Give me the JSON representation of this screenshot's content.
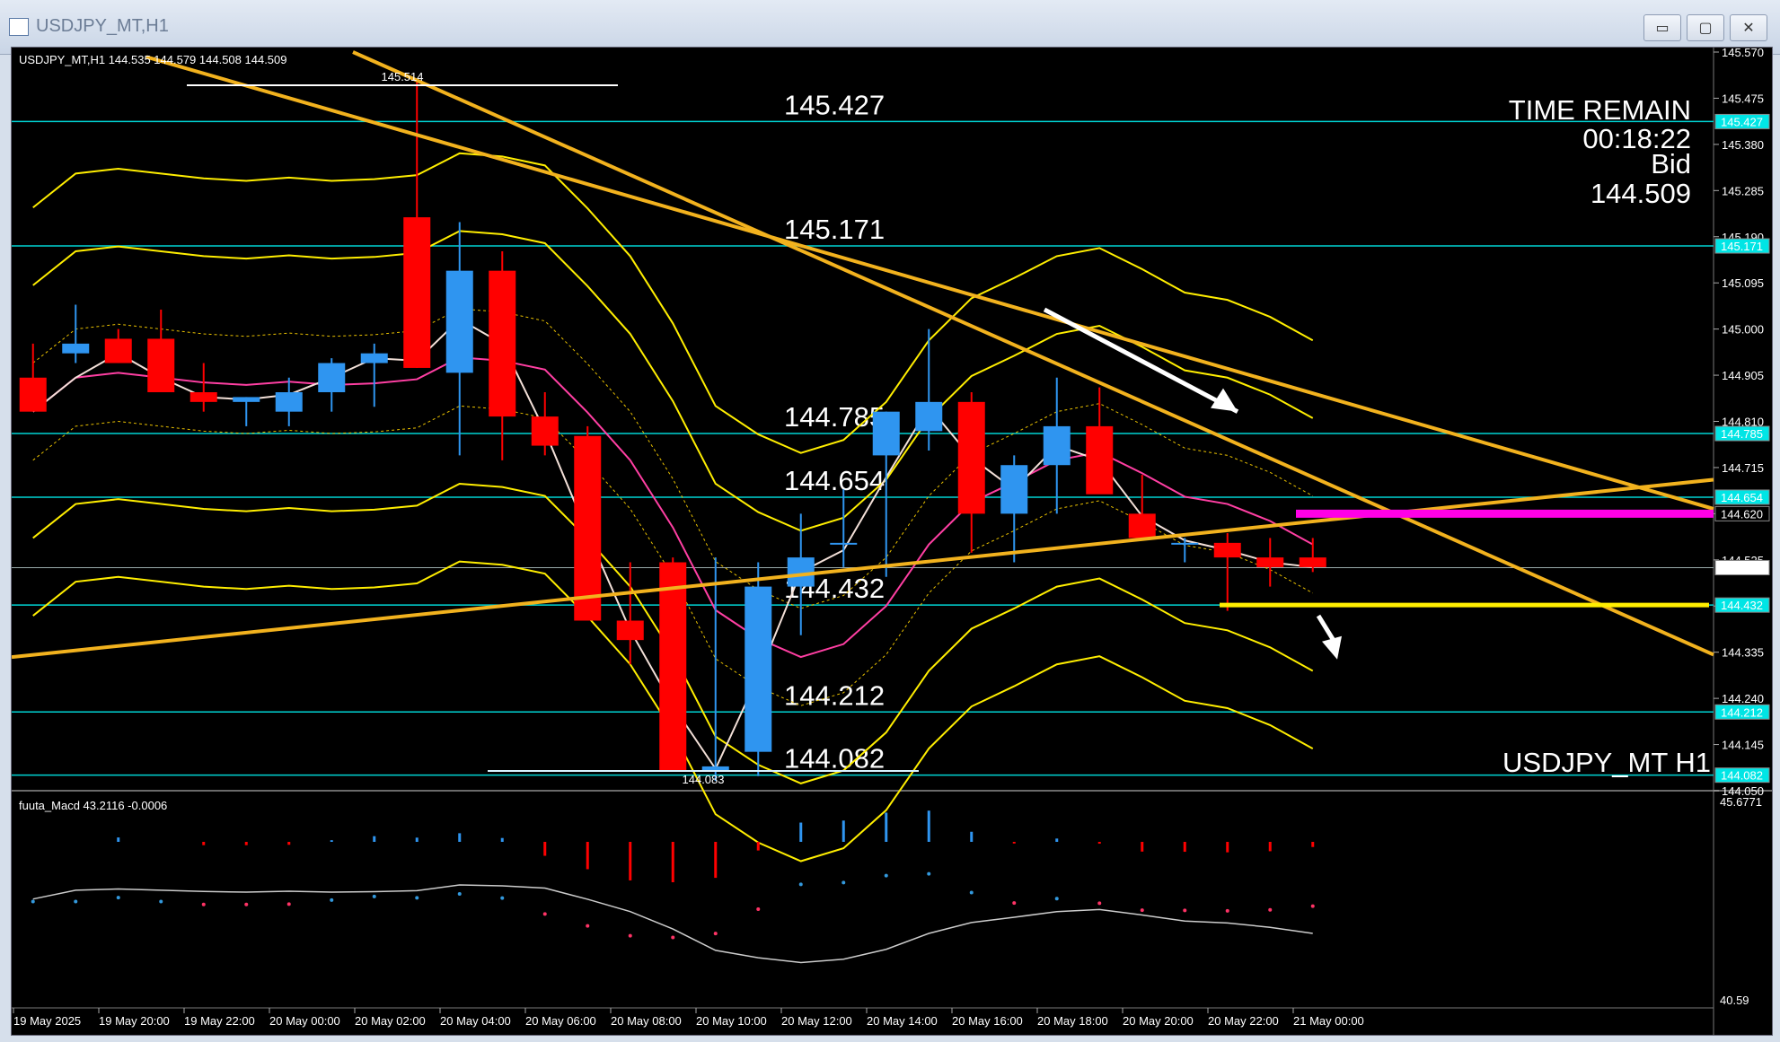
{
  "window": {
    "title": "USDJPY_MT,H1",
    "buttons": [
      "▭",
      "▢",
      "✕"
    ]
  },
  "chart": {
    "info_line": "USDJPY_MT,H1  144.535 144.579 144.508 144.509",
    "high_marker": "145.514",
    "low_marker": "144.083",
    "time_remain_label": "TIME REMAIN",
    "time_remain_value": "00:18:22",
    "bid_label": "Bid",
    "bid_value": "144.509",
    "symbol_watermark": "USDJPY_MT H1",
    "level_labels": [
      "145.427",
      "145.171",
      "144.785",
      "144.654",
      "144.432",
      "144.212",
      "144.082"
    ],
    "price_axis": [
      "145.570",
      "145.475",
      "145.380",
      "145.285",
      "145.190",
      "145.095",
      "145.000",
      "144.905",
      "144.810",
      "144.715",
      "144.620",
      "144.525",
      "144.430",
      "144.335",
      "144.240",
      "144.145",
      "144.050"
    ],
    "price_tags": [
      {
        "value": "145.427",
        "color": "#00e5e5"
      },
      {
        "value": "145.171",
        "color": "#00e5e5"
      },
      {
        "value": "144.785",
        "color": "#00e5e5"
      },
      {
        "value": "144.654",
        "color": "#00e5e5"
      },
      {
        "value": "144.620",
        "color": "#000000"
      },
      {
        "value": "144.509",
        "color": "#ffffff"
      },
      {
        "value": "144.432",
        "color": "#00e5e5"
      },
      {
        "value": "144.212",
        "color": "#00e5e5"
      },
      {
        "value": "144.082",
        "color": "#00e5e5"
      }
    ],
    "time_axis": [
      "19 May 2025",
      "19 May 20:00",
      "19 May 22:00",
      "20 May 00:00",
      "20 May 02:00",
      "20 May 04:00",
      "20 May 06:00",
      "20 May 08:00",
      "20 May 10:00",
      "20 May 12:00",
      "20 May 14:00",
      "20 May 16:00",
      "20 May 18:00",
      "20 May 20:00",
      "20 May 22:00",
      "21 May 00:00"
    ]
  },
  "macd": {
    "label": "fuuta_Macd 43.2116  -0.0006",
    "axis_top": "45.6771",
    "axis_bottom": "40.59"
  },
  "colors": {
    "bull": "#2f95f0",
    "bear": "#ff0000",
    "level_line": "#00d4d4",
    "trendline": "#f2b21e",
    "band": "#ffee00",
    "magenta": "#ff00e6"
  },
  "chart_data": {
    "type": "candlestick",
    "title": "USDJPY_MT,H1",
    "x": [
      "19 May 2025 18:00",
      "19 May 19:00",
      "19 May 20:00",
      "19 May 21:00",
      "19 May 22:00",
      "19 May 23:00",
      "20 May 00:00",
      "20 May 01:00",
      "20 May 02:00",
      "20 May 03:00",
      "20 May 04:00",
      "20 May 05:00",
      "20 May 06:00",
      "20 May 07:00",
      "20 May 08:00",
      "20 May 09:00",
      "20 May 10:00",
      "20 May 11:00",
      "20 May 12:00",
      "20 May 13:00",
      "20 May 14:00",
      "20 May 15:00",
      "20 May 16:00",
      "20 May 17:00",
      "20 May 18:00",
      "20 May 19:00",
      "20 May 20:00",
      "20 May 21:00",
      "20 May 22:00",
      "20 May 23:00",
      "21 May 00:00"
    ],
    "open": [
      144.9,
      144.95,
      144.98,
      144.98,
      144.87,
      144.85,
      144.83,
      144.87,
      144.93,
      145.23,
      144.91,
      145.12,
      144.82,
      144.78,
      144.4,
      144.52,
      144.09,
      144.13,
      144.47,
      144.56,
      144.74,
      144.79,
      144.85,
      144.62,
      144.72,
      144.8,
      144.62,
      144.56,
      144.56,
      144.53,
      144.53
    ],
    "high": [
      144.97,
      145.05,
      145.0,
      145.04,
      144.93,
      144.86,
      144.9,
      144.94,
      144.97,
      145.51,
      145.22,
      145.16,
      144.87,
      144.8,
      144.52,
      144.53,
      144.53,
      144.52,
      144.62,
      144.67,
      144.83,
      145.0,
      144.87,
      144.74,
      144.9,
      144.88,
      144.7,
      144.57,
      144.58,
      144.57,
      144.57
    ],
    "low": [
      144.83,
      144.93,
      144.93,
      144.93,
      144.83,
      144.8,
      144.8,
      144.83,
      144.84,
      144.92,
      144.74,
      144.73,
      144.74,
      144.7,
      144.31,
      144.33,
      144.07,
      144.08,
      144.37,
      144.51,
      144.49,
      144.75,
      144.54,
      144.52,
      144.62,
      144.71,
      144.6,
      144.52,
      144.42,
      144.47,
      144.5
    ],
    "close": [
      144.83,
      144.97,
      144.93,
      144.87,
      144.85,
      144.86,
      144.87,
      144.93,
      144.95,
      144.92,
      145.12,
      144.82,
      144.76,
      144.4,
      144.36,
      144.09,
      144.1,
      144.47,
      144.53,
      144.56,
      144.83,
      144.85,
      144.62,
      144.72,
      144.8,
      144.66,
      144.57,
      144.56,
      144.53,
      144.51,
      144.51
    ],
    "ylim": [
      144.05,
      145.57
    ],
    "levels": [
      145.427,
      145.171,
      144.785,
      144.654,
      144.432,
      144.212,
      144.082
    ],
    "current_bid": 144.509
  }
}
